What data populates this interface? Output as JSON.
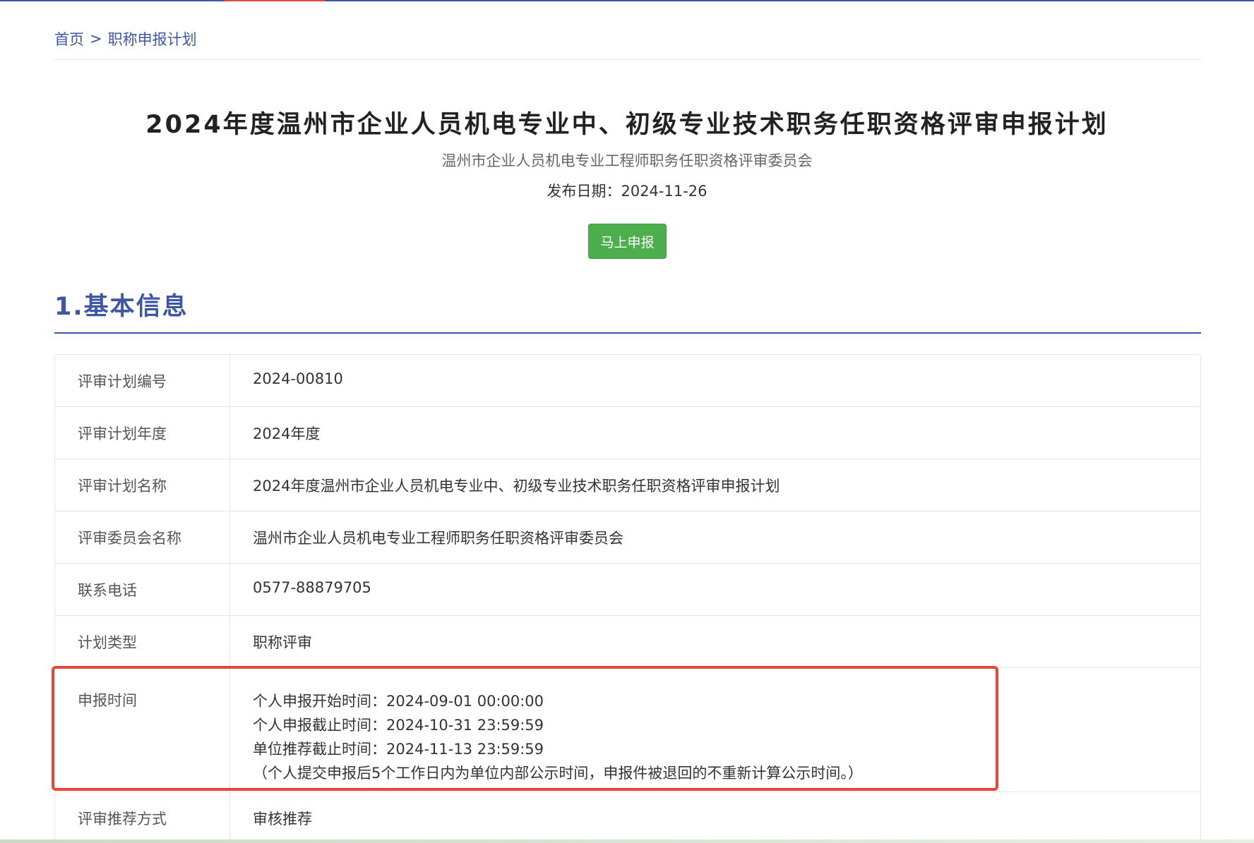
{
  "breadcrumb": {
    "home": "首页",
    "separator": ">",
    "current": "职称申报计划"
  },
  "header": {
    "title": "2024年度温州市企业人员机电专业中、初级专业技术职务任职资格评审申报计划",
    "committee": "温州市企业人员机电专业工程师职务任职资格评审委员会",
    "publish_date": "发布日期：2024-11-26"
  },
  "apply_button": "马上申报",
  "section": {
    "title": "1.基本信息"
  },
  "info": {
    "plan_no_label": "评审计划编号",
    "plan_no": "2024-00810",
    "plan_year_label": "评审计划年度",
    "plan_year": "2024年度",
    "plan_name_label": "评审计划名称",
    "plan_name": "2024年度温州市企业人员机电专业中、初级专业技术职务任职资格评审申报计划",
    "committee_label": "评审委员会名称",
    "committee": "温州市企业人员机电专业工程师职务任职资格评审委员会",
    "phone_label": "联系电话",
    "phone": "0577-88879705",
    "type_label": "计划类型",
    "type": "职称评审",
    "time_label": "申报时间",
    "time_personal_start": "个人申报开始时间：2024-09-01 00:00:00",
    "time_personal_end": "个人申报截止时间：2024-10-31 23:59:59",
    "time_unit_end": "单位推荐截止时间：2024-11-13 23:59:59",
    "time_note": "（个人提交申报后5个工作日内为单位内部公示时间，申报件被退回的不重新计算公示时间。）",
    "recommend_label": "评审推荐方式",
    "recommend": "审核推荐"
  },
  "colors": {
    "brand_blue": "#3d56a6",
    "button_green": "#4cae4c",
    "highlight_red": "#e8443a"
  }
}
